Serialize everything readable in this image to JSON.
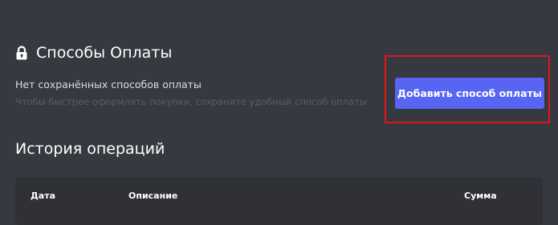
{
  "payment_methods": {
    "title": "Способы Оплаты",
    "icon": "lock-icon",
    "empty_title": "Нет сохранённых способов оплаты",
    "empty_subtitle": "Чтобы быстрее оформлять покупки, сохраните удобный способ оплаты",
    "add_button_label": "Добавить способ оплаты"
  },
  "history": {
    "title": "История операций",
    "columns": [
      "Дата",
      "Описание",
      "Сумма"
    ]
  },
  "colors": {
    "background": "#36393f",
    "table_background": "#2f3136",
    "accent": "#5865f2",
    "highlight": "#e4141b"
  }
}
